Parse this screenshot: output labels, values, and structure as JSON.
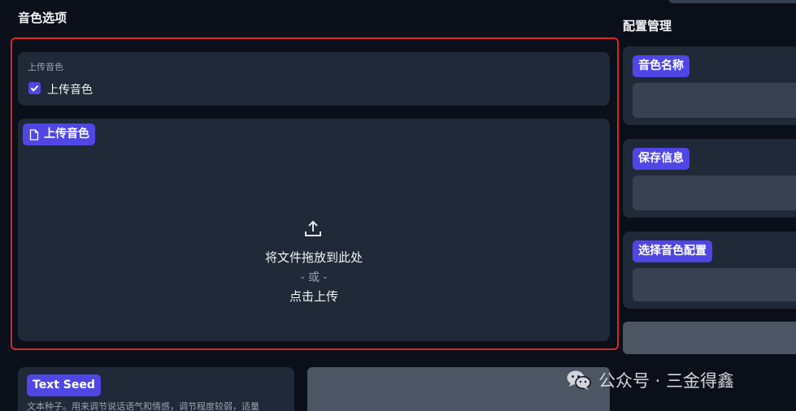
{
  "left": {
    "section_title": "音色选项",
    "upload_checkbox": {
      "caption": "上传音色",
      "label": "上传音色",
      "checked": true
    },
    "file_upload": {
      "badge_label": "上传音色",
      "drop_text": "将文件拖放到此处",
      "or_text": "- 或 -",
      "click_text": "点击上传"
    },
    "text_seed": {
      "badge_label": "Text Seed",
      "description": "文本种子。用来调节说话语气和情感，调节程度较弱，适量"
    }
  },
  "right": {
    "section_title": "配置管理",
    "voice_name_label": "音色名称",
    "save_info_label": "保存信息",
    "select_config_label": "选择音色配置"
  },
  "watermark": {
    "text": "公众号 · 三金得鑫"
  },
  "colors": {
    "background": "#0b0f19",
    "block": "#1f2937",
    "field": "#374151",
    "accent": "#4f46e5",
    "highlight_border": "#dc2626"
  }
}
